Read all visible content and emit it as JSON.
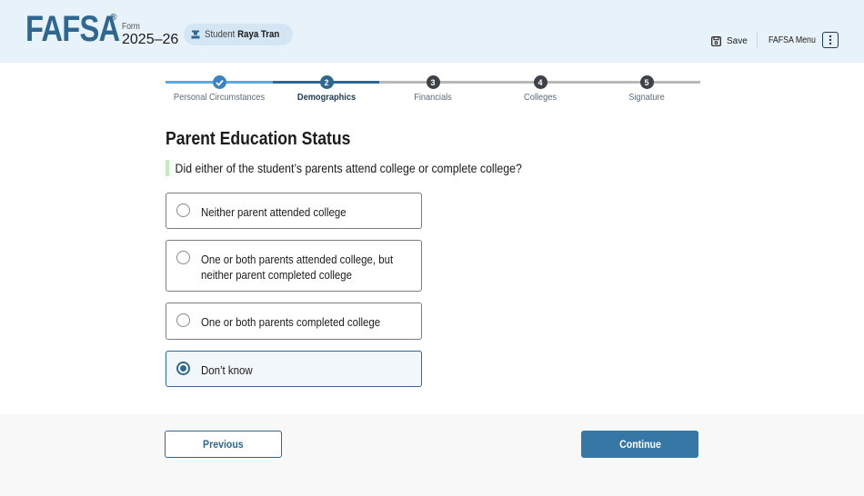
{
  "header": {
    "logo": "FAFSA",
    "logo_mark": "®",
    "form_label": "Form",
    "form_year": "2025–26",
    "student_prefix": "Student",
    "student_name": "Raya Tran",
    "save_label": "Save",
    "menu_label": "FAFSA Menu"
  },
  "stepper": {
    "steps": [
      {
        "number": "1",
        "label": "Personal Circumstances",
        "status": "complete"
      },
      {
        "number": "2",
        "label": "Demographics",
        "status": "current"
      },
      {
        "number": "3",
        "label": "Financials",
        "status": "upcoming"
      },
      {
        "number": "4",
        "label": "Colleges",
        "status": "upcoming"
      },
      {
        "number": "5",
        "label": "Signature",
        "status": "upcoming"
      }
    ]
  },
  "main": {
    "title": "Parent Education Status",
    "question": "Did either of the student’s parents attend college or complete college?",
    "options": [
      {
        "label": "Neither parent attended college",
        "selected": false
      },
      {
        "label": "One or both parents attended college, but neither parent completed college",
        "selected": false
      },
      {
        "label": "One or both parents completed college",
        "selected": false
      },
      {
        "label": "Don’t know",
        "selected": true
      }
    ]
  },
  "footer": {
    "previous_label": "Previous",
    "continue_label": "Continue"
  },
  "colors": {
    "brand": "#2e6891",
    "header_bg": "#e8f2fa",
    "accent_bar": "#c8ebc4",
    "continue_bg": "#3677a5"
  }
}
